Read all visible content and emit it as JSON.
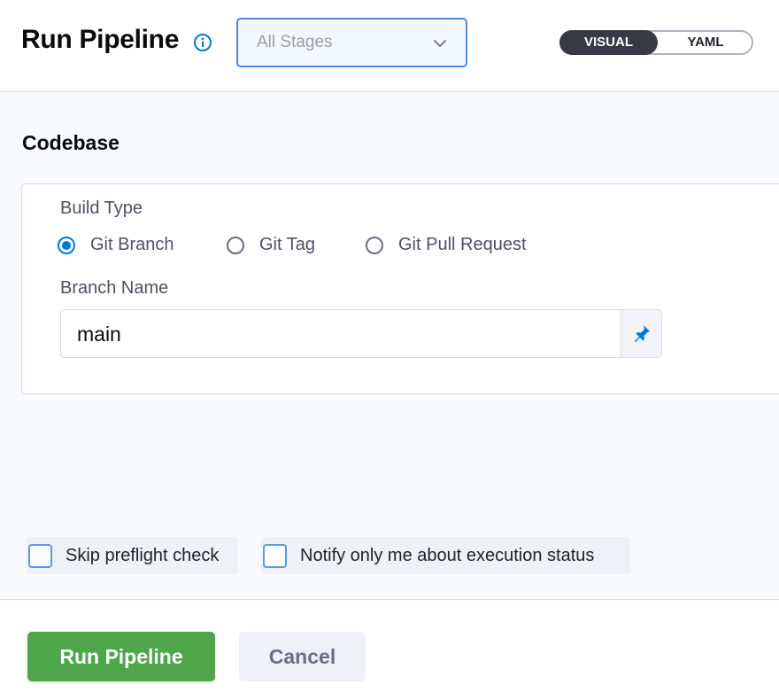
{
  "header": {
    "title": "Run Pipeline",
    "info_icon": "info-icon",
    "stage_select": {
      "value": "All Stages",
      "icon": "chevron-down-icon"
    },
    "view_toggle": {
      "options": [
        "VISUAL",
        "YAML"
      ],
      "selected": "VISUAL"
    }
  },
  "codebase": {
    "title": "Codebase",
    "build_type_label": "Build Type",
    "build_types": [
      "Git Branch",
      "Git Tag",
      "Git Pull Request"
    ],
    "selected_build_type": "Git Branch",
    "branch_name_label": "Branch Name",
    "branch_name_value": "main",
    "pin_icon": "pin-icon"
  },
  "options": {
    "skip_preflight": {
      "label": "Skip preflight check",
      "checked": false
    },
    "notify_only_me": {
      "label": "Notify only me about execution status",
      "checked": false
    }
  },
  "footer": {
    "run_label": "Run Pipeline",
    "cancel_label": "Cancel"
  },
  "colors": {
    "accent_blue": "#0278d5",
    "run_green": "#4fa54a",
    "toggle_dark": "#383946",
    "background": "#f8fafd"
  }
}
